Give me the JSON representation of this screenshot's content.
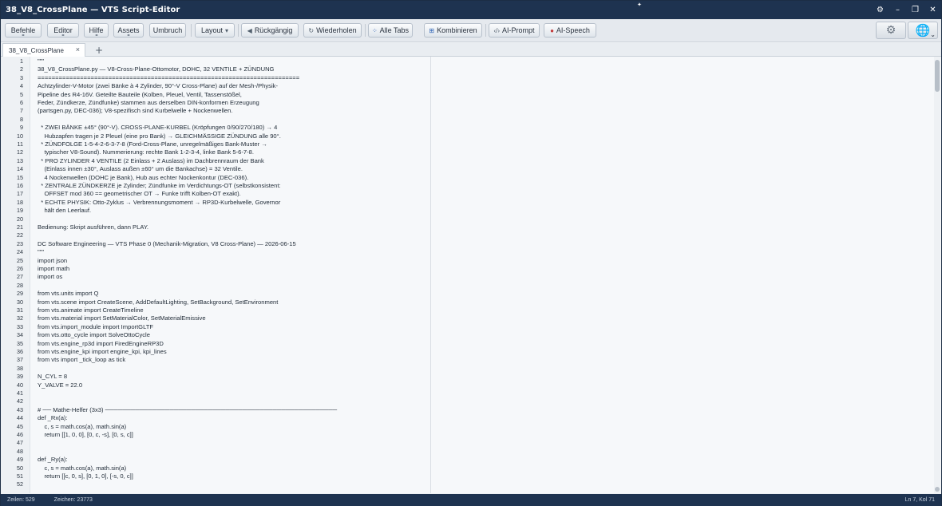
{
  "window": {
    "title": "38_V8_CrossPlane — VTS Script-Editor"
  },
  "window_controls": {
    "settings_glyph": "⚙",
    "minimize_glyph": "–",
    "maximize_glyph": "❐",
    "close_glyph": "✕"
  },
  "toolbar": {
    "befehle": "Befehle",
    "editor": "Editor",
    "hilfe": "Hilfe",
    "assets": "Assets",
    "umbruch": "Umbruch",
    "layout": "Layout",
    "rueckgaengig": "Rückgängig",
    "wiederholen": "Wiederholen",
    "alle_tabs": "Alle Tabs",
    "kombinieren": "Kombinieren",
    "ai_prompt": "AI-Prompt",
    "ai_speech": "AI-Speech",
    "settings_glyph": "⚙",
    "globe_glyph": "🌐"
  },
  "tabs": [
    {
      "label": "38_V8_CrossPlane",
      "close": "×"
    }
  ],
  "tab_add": "+",
  "editor": {
    "line_numbers": [
      "1",
      "2",
      "3",
      "4",
      "5",
      "6",
      "7",
      "8",
      "9",
      "10",
      "11",
      "12",
      "13",
      "14",
      "15",
      "16",
      "17",
      "18",
      "19",
      "20",
      "21",
      "22",
      "23",
      "24",
      "25",
      "26",
      "27",
      "28",
      "29",
      "30",
      "31",
      "32",
      "33",
      "34",
      "35",
      "36",
      "37",
      "38",
      "39",
      "40",
      "41",
      "42",
      "43",
      "44",
      "45",
      "46",
      "47",
      "48",
      "49",
      "50",
      "51",
      "52"
    ],
    "lines": [
      "\"\"\"",
      "38_V8_CrossPlane.py — V8-Cross-Plane-Ottomotor, DOHC, 32 VENTILE + ZÜNDUNG",
      "==========================================================================",
      "Achtzylinder-V-Motor (zwei Bänke à 4 Zylinder, 90°-V Cross-Plane) auf der Mesh-/Physik-",
      "Pipeline des R4-16V. Geteilte Bauteile (Kolben, Pleuel, Ventil, Tassenstößel,",
      "Feder, Zündkerze, Zündfunke) stammen aus derselben DIN-konformen Erzeugung",
      "(partsgen.py, DEC-036); V8-spezifisch sind Kurbelwelle + Nockenwellen.",
      "",
      "  * ZWEI BÄNKE ±45° (90°-V). CROSS-PLANE-KURBEL (Kröpfungen 0/90/270/180) → 4",
      "    Hubzapfen tragen je 2 Pleuel (eine pro Bank) → GLEICHMÄSSIGE ZÜNDUNG alle 90°.",
      "  * ZÜNDFOLGE 1-5-4-2-6-3-7-8 (Ford-Cross-Plane, unregelmäßiges Bank-Muster →",
      "    typischer V8-Sound). Nummerierung: rechte Bank 1-2-3-4, linke Bank 5-6-7-8.",
      "  * PRO ZYLINDER 4 VENTILE (2 Einlass + 2 Auslass) im Dachbrennraum der Bank",
      "    (Einlass innen ±30°, Auslass außen ±60° um die Bankachse) = 32 Ventile.",
      "    4 Nockenwellen (DOHC je Bank), Hub aus echter Nockenkontur (DEC-036).",
      "  * ZENTRALE ZÜNDKERZE je Zylinder; Zündfunke im Verdichtungs-OT (selbstkonsistent:",
      "    OFFSET mod 360 == geometrischer OT → Funke trifft Kolben-OT exakt).",
      "  * ECHTE PHYSIK: Otto-Zyklus → Verbrennungsmoment → RP3D-Kurbelwelle, Governor",
      "    hält den Leerlauf.",
      "",
      "Bedienung: Skript ausführen, dann PLAY.",
      "",
      "DC Software Engineering — VTS Phase 0 (Mechanik-Migration, V8 Cross-Plane) — 2026-06-15",
      "\"\"\"",
      "import json",
      "import math",
      "import os",
      "",
      "from vts.units import Q",
      "from vts.scene import CreateScene, AddDefaultLighting, SetBackground, SetEnvironment",
      "from vts.animate import CreateTimeline",
      "from vts.material import SetMaterialColor, SetMaterialEmissive",
      "from vts.import_module import ImportGLTF",
      "from vts.otto_cycle import SolveOttoCycle",
      "from vts.engine_rp3d import FiredEngineRP3D",
      "from vts.engine_kpi import engine_kpi, kpi_lines",
      "from vts import _tick_loop as tick",
      "",
      "N_CYL = 8",
      "Y_VALVE = 22.0",
      "",
      "",
      "# ── Mathe-Helfer (3x3) ──────────────────────────────────────────────────────",
      "def _Rx(a):",
      "    c, s = math.cos(a), math.sin(a)",
      "    return [[1, 0, 0], [0, c, -s], [0, s, c]]",
      "",
      "",
      "def _Ry(a):",
      "    c, s = math.cos(a), math.sin(a)",
      "    return [[c, 0, s], [0, 1, 0], [-s, 0, c]]",
      ""
    ]
  },
  "status": {
    "zeilen": "Zeilen: 529",
    "zeichen": "Zeichen: 23773",
    "position": "Ln 7, Kol 71"
  }
}
